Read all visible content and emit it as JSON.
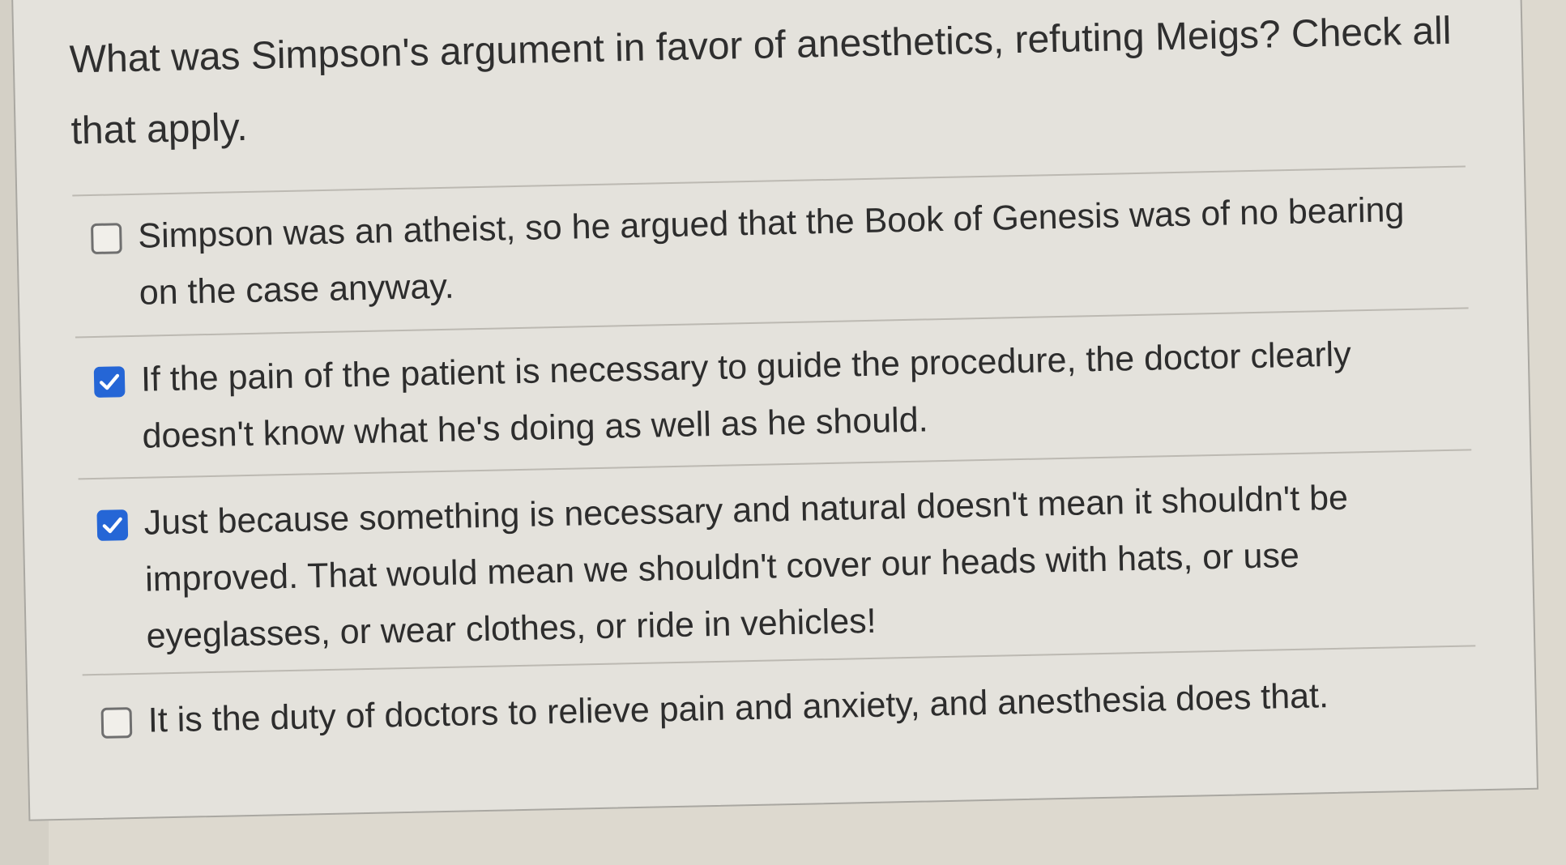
{
  "question": {
    "text": "What was Simpson's argument in favor of anesthetics, refuting Meigs?  Check all that apply."
  },
  "options": [
    {
      "label": "Simpson was an atheist, so he argued that the Book of Genesis was of no bearing on the case anyway.",
      "checked": false
    },
    {
      "label": "If the pain of the patient is necessary to guide the procedure, the doctor clearly doesn't know what he's doing as well as he should.",
      "checked": true
    },
    {
      "label": "Just because something is necessary and natural doesn't mean it shouldn't be improved. That would mean we shouldn't cover our heads with hats, or use eyeglasses, or wear clothes, or ride in vehicles!",
      "checked": true
    },
    {
      "label": "It is the duty of doctors to relieve pain and anxiety, and anesthesia does that.",
      "checked": false
    }
  ],
  "colors": {
    "checkbox_checked": "#2566d6",
    "text": "#2d2d2d"
  }
}
